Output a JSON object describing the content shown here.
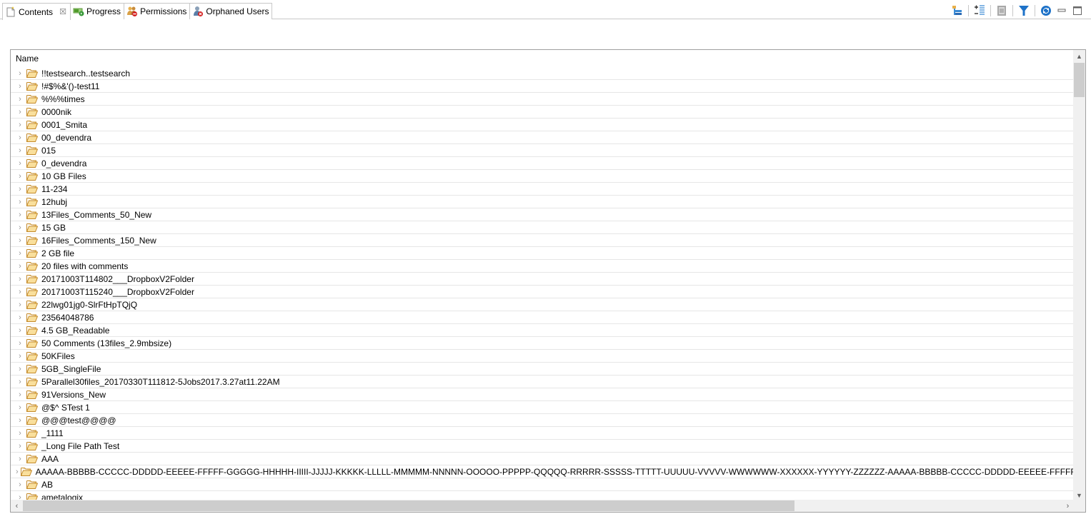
{
  "tabs": [
    {
      "label": "Contents",
      "icon": "contents-icon",
      "active": true,
      "closable": true
    },
    {
      "label": "Progress",
      "icon": "progress-icon",
      "active": false
    },
    {
      "label": "Permissions",
      "icon": "permissions-icon",
      "active": false
    },
    {
      "label": "Orphaned Users",
      "icon": "orphaned-users-icon",
      "active": false
    }
  ],
  "tab_close_glyph": "☒",
  "toolbar": {
    "buttons": [
      "hierarchy-icon",
      "expand-collapse-icon",
      "document-icon",
      "filter-icon",
      "refresh-icon",
      "minimize-icon",
      "maximize-icon"
    ]
  },
  "tree": {
    "column_header": "Name",
    "chevron_glyph": "›",
    "rows": [
      "!!testsearch..testsearch",
      "!#$%&'()-test11",
      "%%%times",
      "0000nik",
      "0001_Smita",
      "00_devendra",
      "015",
      "0_devendra",
      "10 GB Files",
      "11-234",
      "12hubj",
      "13Files_Comments_50_New",
      "15 GB",
      "16Files_Comments_150_New",
      "2 GB file",
      "20 files with comments",
      "20171003T114802___DropboxV2Folder",
      "20171003T115240___DropboxV2Folder",
      "22lwg01jg0-SlrFtHpTQjQ",
      "23564048786",
      "4.5 GB_Readable",
      "50 Comments (13files_2.9mbsize)",
      "50KFiles",
      "5GB_SingleFile",
      "5Parallel30files_20170330T111812-5Jobs2017.3.27at11.22AM",
      "91Versions_New",
      "@$^ STest 1",
      "@@@test@@@@",
      "_1111",
      "_Long File Path Test",
      "AAA",
      "AAAAA-BBBBB-CCCCC-DDDDD-EEEEE-FFFFF-GGGGG-HHHHH-IIIII-JJJJJ-KKKKK-LLLLL-MMMMM-NNNNN-OOOOO-PPPPP-QQQQQ-RRRRR-SSSSS-TTTTT-UUUUU-VVVVV-WWWWWW-XXXXXX-YYYYYY-ZZZZZZ-AAAAA-BBBBB-CCCCC-DDDDD-EEEEE-FFFFF-GGGGG-HHHHH",
      "AB",
      "ametalogix"
    ]
  },
  "scrollbars": {
    "up_glyph": "▲",
    "down_glyph": "▼",
    "left_glyph": "‹",
    "right_glyph": "›"
  },
  "colors": {
    "folder": "#e8b04a",
    "border": "#a0a0a0",
    "scroll_track": "#f0f0f0",
    "scroll_thumb": "#cdcdcd",
    "filter_blue": "#1e72c8"
  }
}
